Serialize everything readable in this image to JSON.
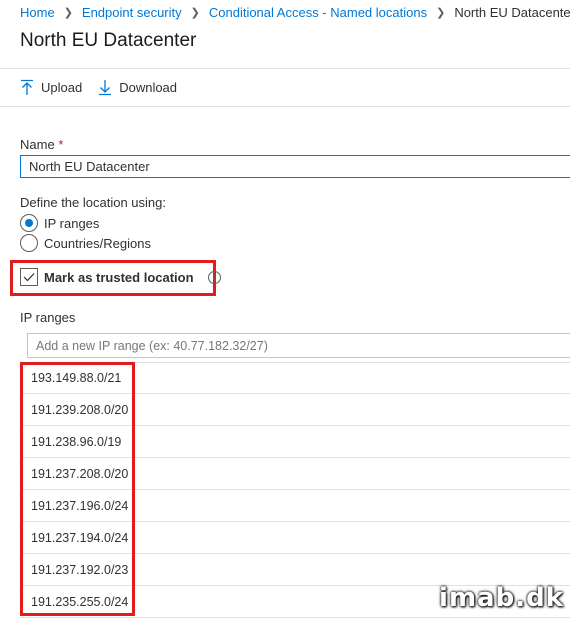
{
  "breadcrumb": {
    "items": [
      "Home",
      "Endpoint security",
      "Conditional Access - Named locations"
    ],
    "current": "North EU Datacenter"
  },
  "page": {
    "title": "North EU Datacenter"
  },
  "toolbar": {
    "upload_label": "Upload",
    "download_label": "Download"
  },
  "form": {
    "name_label": "Name",
    "required_mark": "*",
    "name_value": "North EU Datacenter",
    "define_label": "Define the location using:",
    "options": [
      {
        "label": "IP ranges",
        "selected": true
      },
      {
        "label": "Countries/Regions",
        "selected": false
      }
    ],
    "trusted_label": "Mark as trusted location",
    "trusted_checked": true,
    "ip_ranges_label": "IP ranges",
    "ip_placeholder": "Add a new IP range (ex: 40.77.182.32/27)"
  },
  "ip_ranges": [
    "193.149.88.0/21",
    "191.239.208.0/20",
    "191.238.96.0/19",
    "191.237.208.0/20",
    "191.237.196.0/24",
    "191.237.194.0/24",
    "191.237.192.0/23",
    "191.235.255.0/24"
  ],
  "watermark": "imab.dk",
  "colors": {
    "accent": "#0078d4",
    "highlight": "#e21b1b",
    "required": "#a4262c"
  }
}
